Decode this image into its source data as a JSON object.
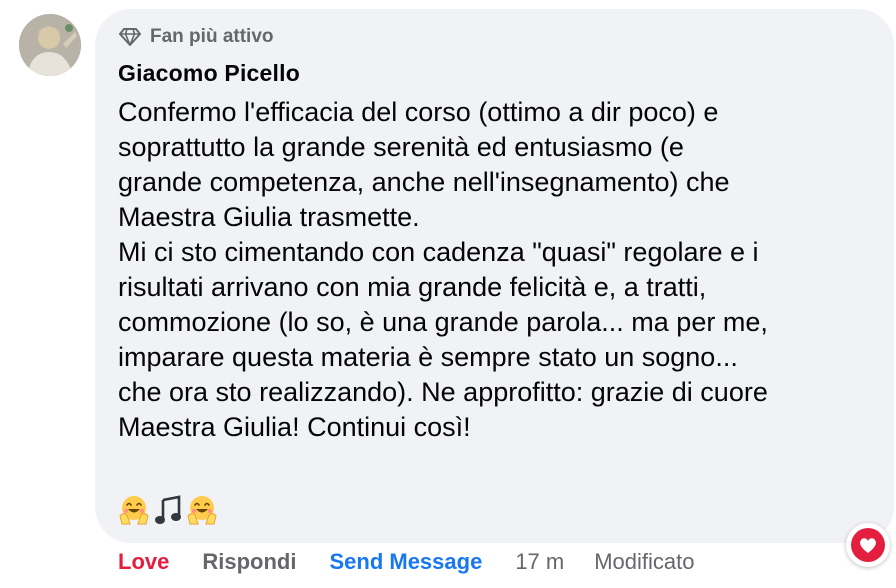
{
  "post": {
    "badge_label": "Fan più attivo",
    "author_name": "Giacomo Picello",
    "body_lines": [
      "Confermo l'efficacia del corso (ottimo a dir poco) e",
      "soprattutto la grande serenità ed entusiasmo (e",
      "grande competenza, anche nell'insegnamento) che",
      "Maestra Giulia trasmette.",
      "Mi ci sto cimentando con cadenza \"quasi\" regolare e i",
      "risultati arrivano con mia grande felicità e, a tratti,",
      "commozione (lo so, è una grande parola... ma per me,",
      "imparare questa materia è sempre stato un sogno...",
      "che ora sto realizzando). Ne approfitto: grazie di cuore",
      "Maestra Giulia! Continui così!"
    ],
    "emojis": [
      "smiling-face-with-open-hands",
      "musical-note",
      "smiling-face-with-open-hands"
    ]
  },
  "actions": {
    "love_label": "Love",
    "reply_label": "Rispondi",
    "send_label": "Send Message",
    "time": "17 m",
    "edited_label": "Modificato"
  },
  "reaction": {
    "icon": "heart-icon",
    "color": "#e41e3f"
  },
  "colors": {
    "bubble": "#f0f2f5",
    "love": "#e41e3f",
    "link": "#1877f2",
    "secondary": "#65676b"
  }
}
